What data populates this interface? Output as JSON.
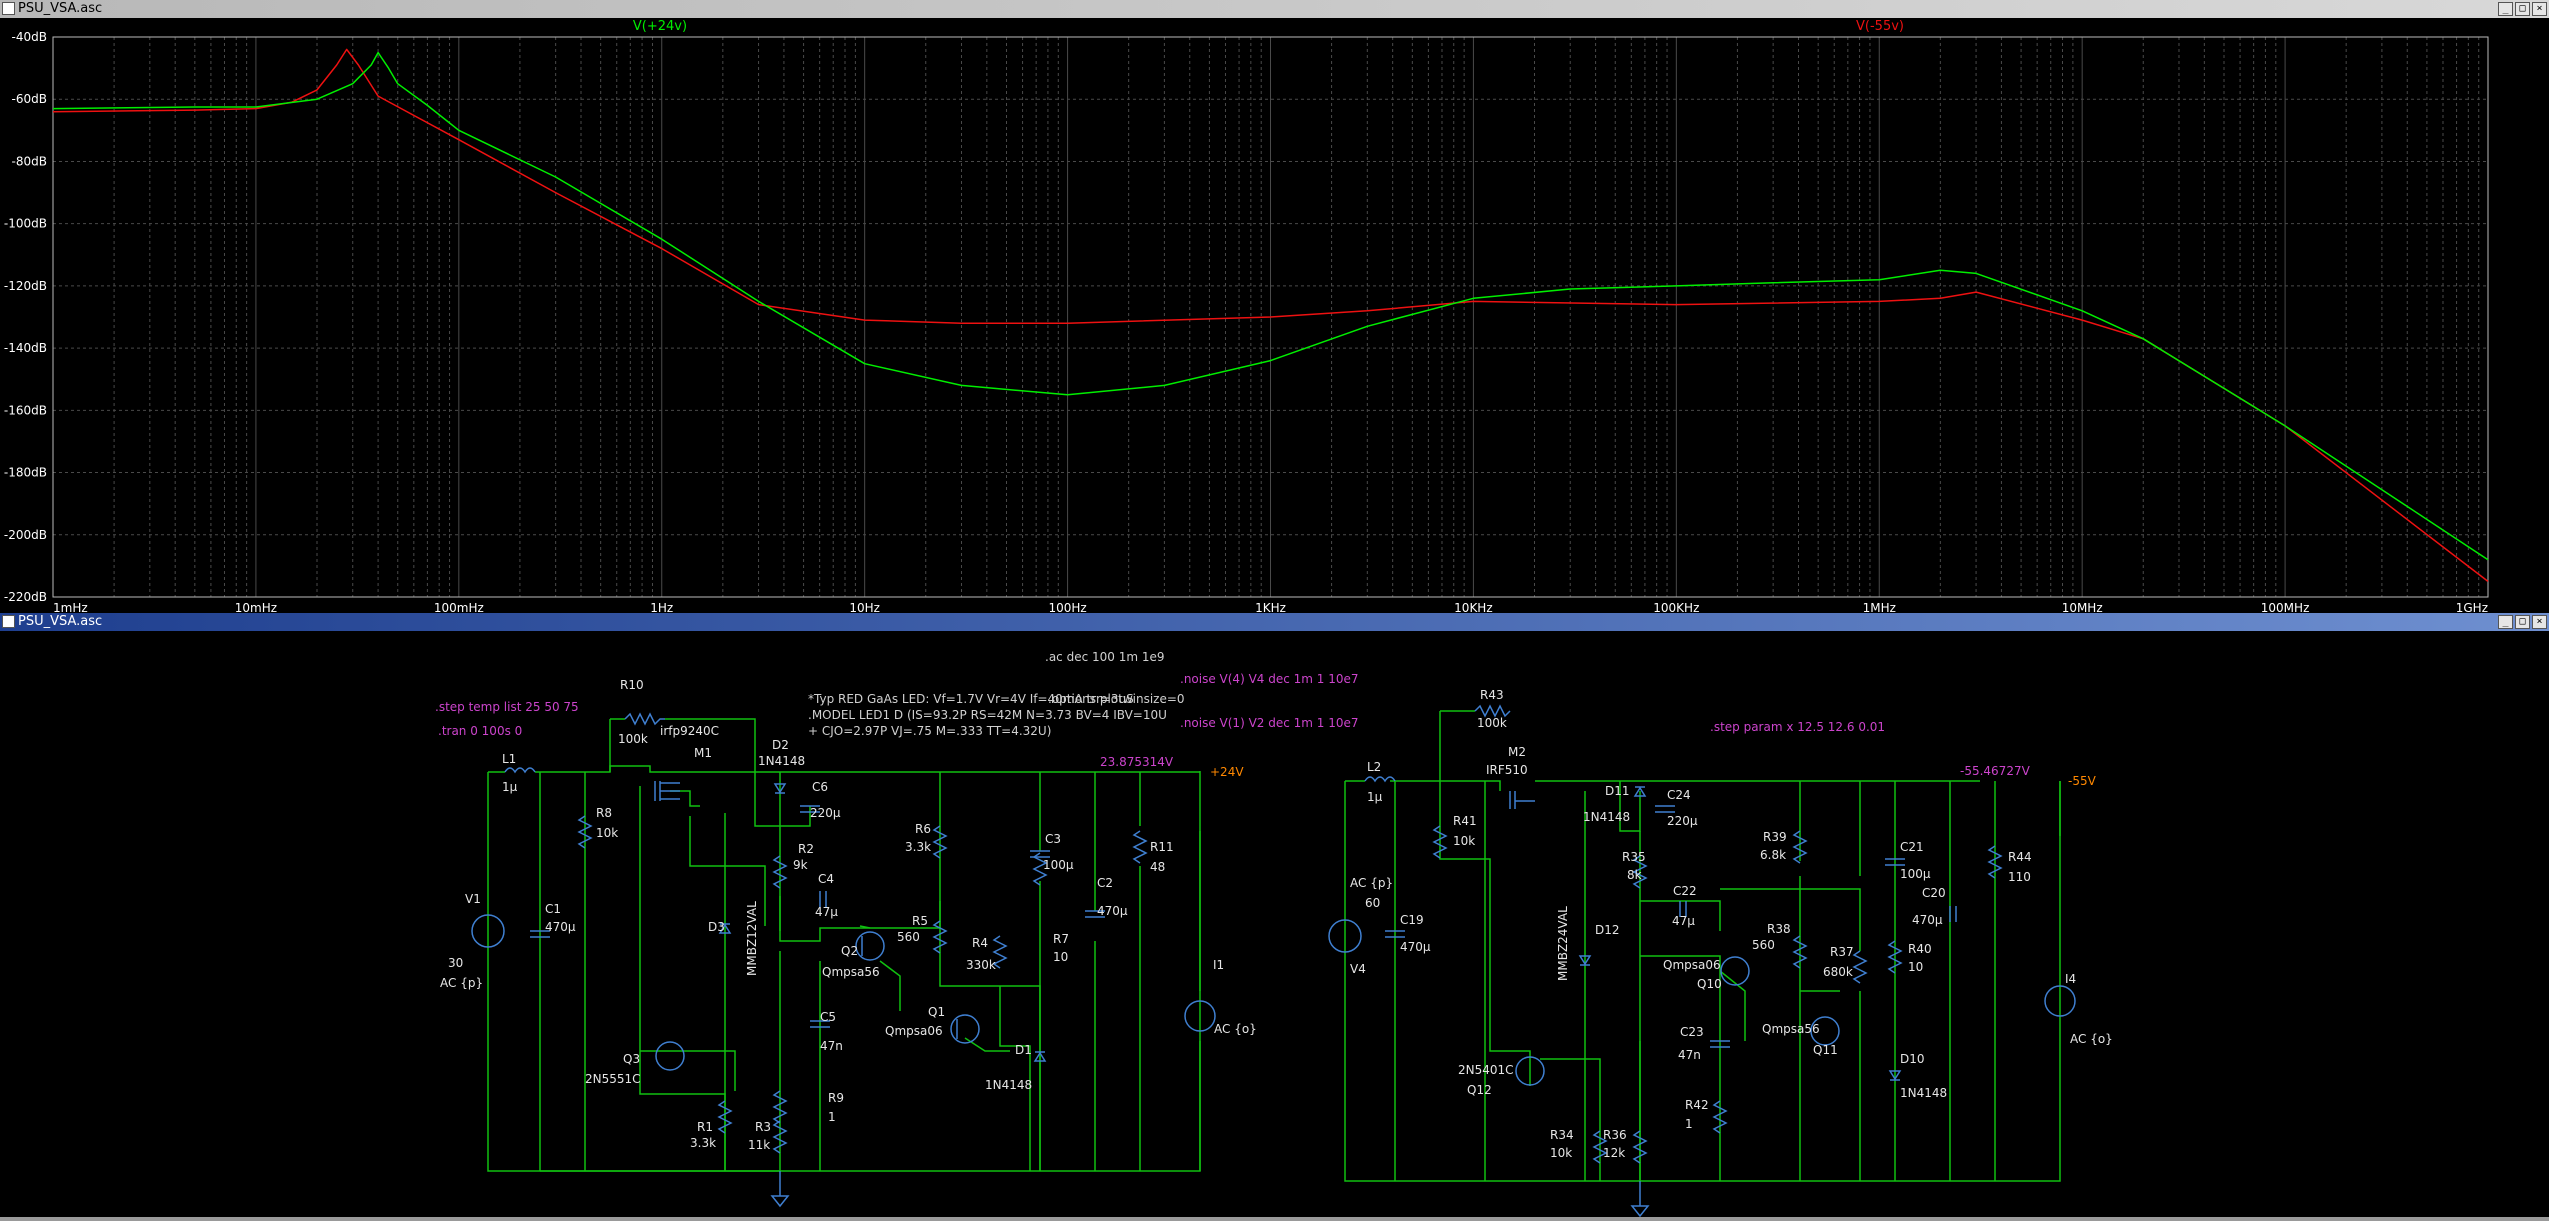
{
  "plot_window": {
    "title": "PSU_VSA.asc",
    "controls": [
      "_",
      "□",
      "×"
    ]
  },
  "schematic_window": {
    "title": "PSU_VSA.asc",
    "controls": [
      "_",
      "□",
      "×"
    ]
  },
  "colors": {
    "trace_pos": "#00ee00",
    "trace_neg": "#ee1111",
    "wire": "#10c010",
    "component": "#3f7fd0",
    "directive": "#cc44cc",
    "node": "#ff8800",
    "grid": "#4a4a4a",
    "axis_text": "#ffffff"
  },
  "chart_data": {
    "type": "line",
    "x_scale": "log",
    "x_range_hz": [
      0.001,
      1000000000
    ],
    "y_range_db": [
      -220,
      -40
    ],
    "grid": true,
    "x_tick_labels": [
      "1mHz",
      "10mHz",
      "100mHz",
      "1Hz",
      "10Hz",
      "100Hz",
      "1KHz",
      "10KHz",
      "100KHz",
      "1MHz",
      "10MHz",
      "100MHz",
      "1GHz"
    ],
    "y_tick_labels": [
      "-40dB",
      "-60dB",
      "-80dB",
      "-100dB",
      "-120dB",
      "-140dB",
      "-160dB",
      "-180dB",
      "-200dB",
      "-220dB"
    ],
    "y_tick_values": [
      -40,
      -60,
      -80,
      -100,
      -120,
      -140,
      -160,
      -180,
      -200,
      -220
    ],
    "x_tick_values": [
      0.001,
      0.01,
      0.1,
      1,
      10,
      100,
      1000,
      10000,
      100000,
      1000000,
      10000000,
      100000000,
      1000000000
    ],
    "series": [
      {
        "name": "V(+24v)",
        "color": "#00ee00",
        "points": [
          [
            0.001,
            -63
          ],
          [
            0.005,
            -62.5
          ],
          [
            0.01,
            -62.5
          ],
          [
            0.02,
            -60
          ],
          [
            0.03,
            -55
          ],
          [
            0.037,
            -49
          ],
          [
            0.04,
            -45
          ],
          [
            0.045,
            -50
          ],
          [
            0.05,
            -55
          ],
          [
            0.07,
            -62
          ],
          [
            0.1,
            -70
          ],
          [
            0.3,
            -85
          ],
          [
            1,
            -105
          ],
          [
            3,
            -125
          ],
          [
            10,
            -145
          ],
          [
            30,
            -152
          ],
          [
            100,
            -155
          ],
          [
            300,
            -152
          ],
          [
            1000,
            -144
          ],
          [
            3000,
            -133
          ],
          [
            10000,
            -124
          ],
          [
            30000,
            -121
          ],
          [
            100000,
            -120
          ],
          [
            300000,
            -119
          ],
          [
            1000000,
            -118
          ],
          [
            2000000,
            -115
          ],
          [
            3000000,
            -116
          ],
          [
            10000000,
            -128
          ],
          [
            20000000,
            -137
          ],
          [
            100000000,
            -165
          ],
          [
            1000000000,
            -208
          ]
        ]
      },
      {
        "name": "V(-55v)",
        "color": "#ee1111",
        "points": [
          [
            0.001,
            -64
          ],
          [
            0.005,
            -63.5
          ],
          [
            0.01,
            -63
          ],
          [
            0.015,
            -61
          ],
          [
            0.02,
            -57
          ],
          [
            0.025,
            -49
          ],
          [
            0.028,
            -44
          ],
          [
            0.032,
            -49
          ],
          [
            0.04,
            -59
          ],
          [
            0.1,
            -73
          ],
          [
            0.3,
            -90
          ],
          [
            1,
            -108
          ],
          [
            3,
            -126
          ],
          [
            10,
            -131
          ],
          [
            30,
            -132
          ],
          [
            100,
            -132
          ],
          [
            1000,
            -130
          ],
          [
            3000,
            -128
          ],
          [
            10000,
            -125
          ],
          [
            100000,
            -126
          ],
          [
            1000000,
            -125
          ],
          [
            2000000,
            -124
          ],
          [
            3000000,
            -122
          ],
          [
            10000000,
            -131
          ],
          [
            20000000,
            -137
          ],
          [
            100000000,
            -165
          ],
          [
            1000000000,
            -215
          ]
        ]
      }
    ]
  },
  "schematic": {
    "directives": {
      "ac": ".ac dec 100 1m 1e9",
      "step_temp": ".step temp list 25 50 75",
      "tran": ".tran 0 100s 0",
      "options": ".options plotwinsize=0",
      "noise4": ".noise V(4) V4 dec 1m 1 10e7",
      "noise1": ".noise V(1) V2 dec 1m 1 10e7",
      "step_param": ".step param x 12.5 12.6 0.01"
    },
    "comment_lines": [
      "*Typ RED GaAs LED: Vf=1.7V Vr=4V If=40mA trr=3uS",
      ".MODEL LED1 D (IS=93.2P RS=42M N=3.73 BV=4 IBV=10U",
      "+ CJO=2.97P VJ=.75 M=.333 TT=4.32U)"
    ],
    "node_pos_value": "23.875314V",
    "node_pos_label": "+24V",
    "node_neg_value": "-55.46727V",
    "node_neg_label": "-55V",
    "labels": {
      "R10": "R10",
      "R10v": "100k",
      "L1": "L1",
      "L1v": "1µ",
      "R8": "R8",
      "R8v": "10k",
      "M1": "M1",
      "M1v": "irfp9240C",
      "D2": "D2",
      "D2v": "1N4148",
      "C6": "C6",
      "C6v": "220µ",
      "R2": "R2",
      "R2v": "9k",
      "C4": "C4",
      "C4v": "47µ",
      "R6": "R6",
      "R6v": "3.3k",
      "C3": "C3",
      "C3v": "100µ",
      "R11": "R11",
      "R11v": "48",
      "C2": "C2",
      "C2v": "470µ",
      "R5": "R5",
      "R5v": "560",
      "R4": "R4",
      "R4v": "330k",
      "R7": "R7",
      "R7v": "10",
      "Q2": "Q2",
      "Q2v": "Qmpsa56",
      "Q1": "Q1",
      "Q1v": "Qmpsa06",
      "C5": "C5",
      "C5v": "47n",
      "D1": "D1",
      "D1v": "1N4148",
      "R9": "R9",
      "R9v": "1",
      "R1": "R1",
      "R1v": "3.3k",
      "R3": "R3",
      "R3v": "11k",
      "Q3": "Q3",
      "Q3v": "2N5551C",
      "D3": "D3",
      "D3v": "MMBZ12VAL",
      "V1": "V1",
      "V1v": "30",
      "V1ac": "AC {p}",
      "C1": "C1",
      "C1v": "470µ",
      "I1": "I1",
      "I1ac": "AC {o}",
      "R43": "R43",
      "R43v": "100k",
      "L2": "L2",
      "L2v": "1µ",
      "M2": "M2",
      "M2v": "IRF510",
      "D11": "D11",
      "D11v": "1N4148",
      "C24": "C24",
      "C24v": "220µ",
      "R41": "R41",
      "R41v": "10k",
      "R35": "R35",
      "R35v": "8k",
      "C22": "C22",
      "C22v": "47µ",
      "R39": "R39",
      "R39v": "6.8k",
      "C21": "C21",
      "C21v": "100µ",
      "R44": "R44",
      "R44v": "110",
      "C20": "C20",
      "C20v": "470µ",
      "R38": "R38",
      "R38v": "560",
      "R37": "R37",
      "R37v": "680k",
      "R40": "R40",
      "R40v": "10",
      "Q10": "Q10",
      "Q10v": "Qmpsa06",
      "Q11": "Q11",
      "Q11v": "Qmpsa56",
      "D12": "D12",
      "D12v": "MMBZ24VAL",
      "C19": "C19",
      "C19v": "470µ",
      "V4": "V4",
      "V4v": "60",
      "V4ac": "AC {p}",
      "C23": "C23",
      "C23v": "47n",
      "D10": "D10",
      "D10v": "1N4148",
      "R42": "R42",
      "R42v": "1",
      "R34": "R34",
      "R34v": "10k",
      "R36": "R36",
      "R36v": "12k",
      "Q12": "Q12",
      "Q12v": "2N5401C",
      "I4": "I4",
      "I4ac": "AC {o}"
    }
  }
}
